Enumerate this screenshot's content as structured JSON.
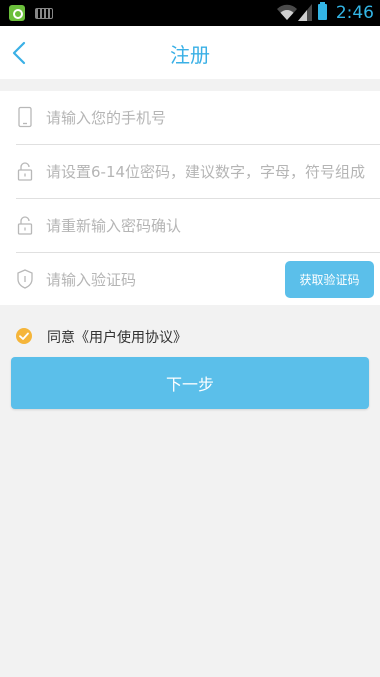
{
  "status_bar": {
    "time": "2:46",
    "accent_color": "#33b5e5"
  },
  "header": {
    "title": "注册",
    "back_icon": "chevron-left-icon"
  },
  "form": {
    "phone": {
      "icon": "phone-icon",
      "placeholder": "请输入您的手机号",
      "value": ""
    },
    "password": {
      "icon": "lock-icon",
      "placeholder": "请设置6-14位密码，建议数字，字母，符号组成",
      "value": ""
    },
    "confirm_password": {
      "icon": "lock-icon",
      "placeholder": "请重新输入密码确认",
      "value": ""
    },
    "verify_code": {
      "icon": "shield-icon",
      "placeholder": "请输入验证码",
      "value": "",
      "button_label": "获取验证码"
    }
  },
  "agreement": {
    "checked": true,
    "label": "同意《用户使用协议》"
  },
  "next_button": {
    "label": "下一步"
  },
  "colors": {
    "primary": "#5bbfea",
    "title": "#3ab0e6",
    "check": "#f5b53a",
    "background": "#f2f2f2"
  }
}
